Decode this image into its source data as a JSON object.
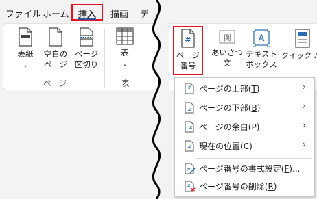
{
  "tabs": [
    {
      "label": "ファイル"
    },
    {
      "label": "ホーム"
    },
    {
      "label": "挿入"
    },
    {
      "label": "描画"
    },
    {
      "label": "デ"
    }
  ],
  "ribbon": {
    "cover": "表紙",
    "blank_page": "空白の\nページ",
    "page_break": "ページ\n区切り",
    "group_pages": "ページ",
    "table": "表",
    "group_table": "表",
    "page_number": "ページ\n番号",
    "greeting": "あいさつ\n文",
    "textbox": "テキスト\nボックス",
    "quick_parts": "クイック パー"
  },
  "menu": {
    "items": [
      {
        "label": "ページの上部(",
        "key": "T",
        "suffix": ")",
        "submenu": true,
        "icon": "page-top-icon"
      },
      {
        "label": "ページの下部(",
        "key": "B",
        "suffix": ")",
        "submenu": true,
        "icon": "page-bottom-icon"
      },
      {
        "label": "ページの余白(",
        "key": "P",
        "suffix": ")",
        "submenu": true,
        "icon": "page-margin-icon"
      },
      {
        "label": "現在の位置(",
        "key": "C",
        "suffix": ")",
        "submenu": true,
        "icon": "current-position-icon"
      },
      {
        "label": "ページ番号の書式設定(",
        "key": "F",
        "suffix": ")...",
        "submenu": false,
        "icon": "format-page-number-icon"
      },
      {
        "label": "ページ番号の削除(",
        "key": "R",
        "suffix": ")",
        "submenu": false,
        "icon": "remove-page-number-icon"
      }
    ],
    "arrow": "›"
  },
  "colors": {
    "accent": "#2b579a",
    "highlight": "#e81123",
    "icon_blue": "#2b6cb0"
  }
}
